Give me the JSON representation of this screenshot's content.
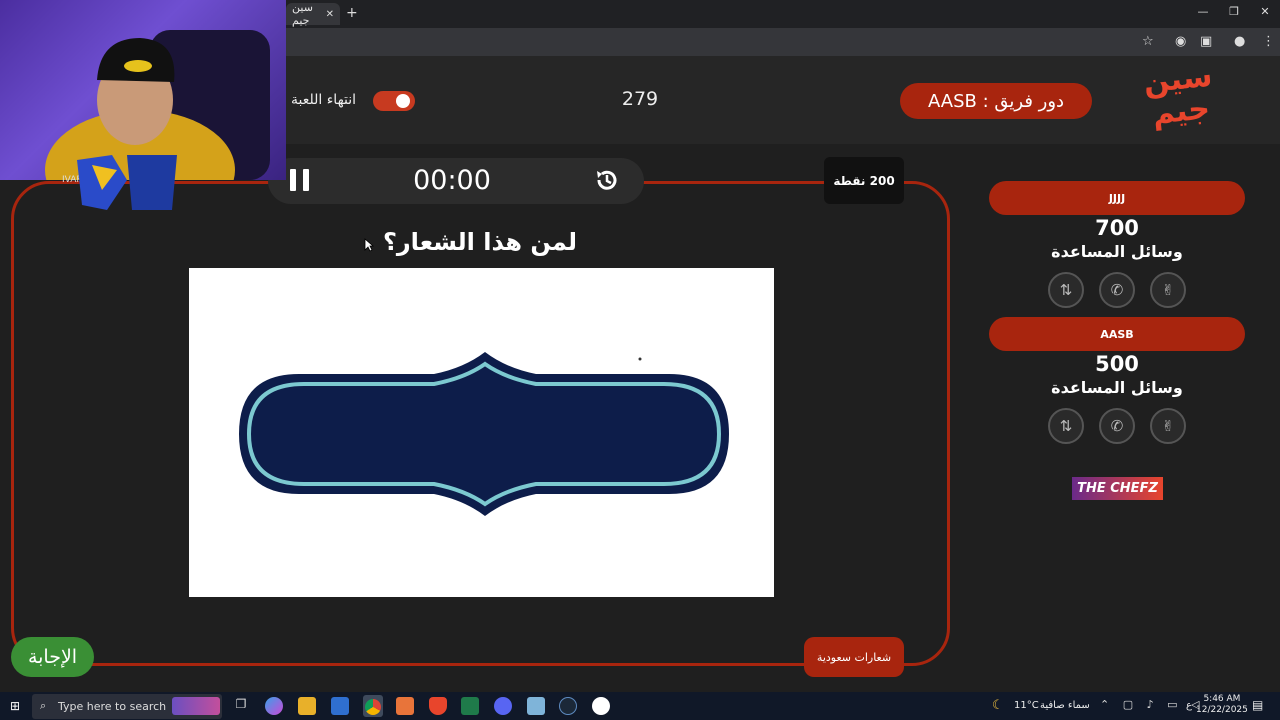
{
  "browser": {
    "tab_title": "سين جيم",
    "tab_close": "✕",
    "new_tab": "+",
    "window_controls": [
      "—",
      "❐",
      "✕"
    ]
  },
  "header": {
    "logo_line1": "سين",
    "logo_line2": "جيم",
    "team_turn": "دور فريق : AASB",
    "score": "279",
    "end_game_label": "انتهاء اللعبة"
  },
  "board": {
    "timer": "00:00",
    "points": "200 نقطة",
    "question": "لمن هذا الشعار؟",
    "category": "شعارات سعودية",
    "answer_button": "الإجابة"
  },
  "teams": [
    {
      "name": "JJJJ",
      "score": "700",
      "helpers_label": "وسائل المساعدة"
    },
    {
      "name": "AASB",
      "score": "500",
      "helpers_label": "وسائل المساعدة"
    }
  ],
  "sponsor": "THE CHEFZ",
  "webcam": {
    "label": "IVAR"
  },
  "taskbar": {
    "search_placeholder": "Type here to search",
    "weather_text": "سماء صافية",
    "temperature": "11°C",
    "time": "5:46 AM",
    "date": "12/22/2025",
    "lang": "ع"
  },
  "colors": {
    "accent": "#a8250e",
    "answer": "#3a8f35",
    "logo": "#e8452c"
  }
}
